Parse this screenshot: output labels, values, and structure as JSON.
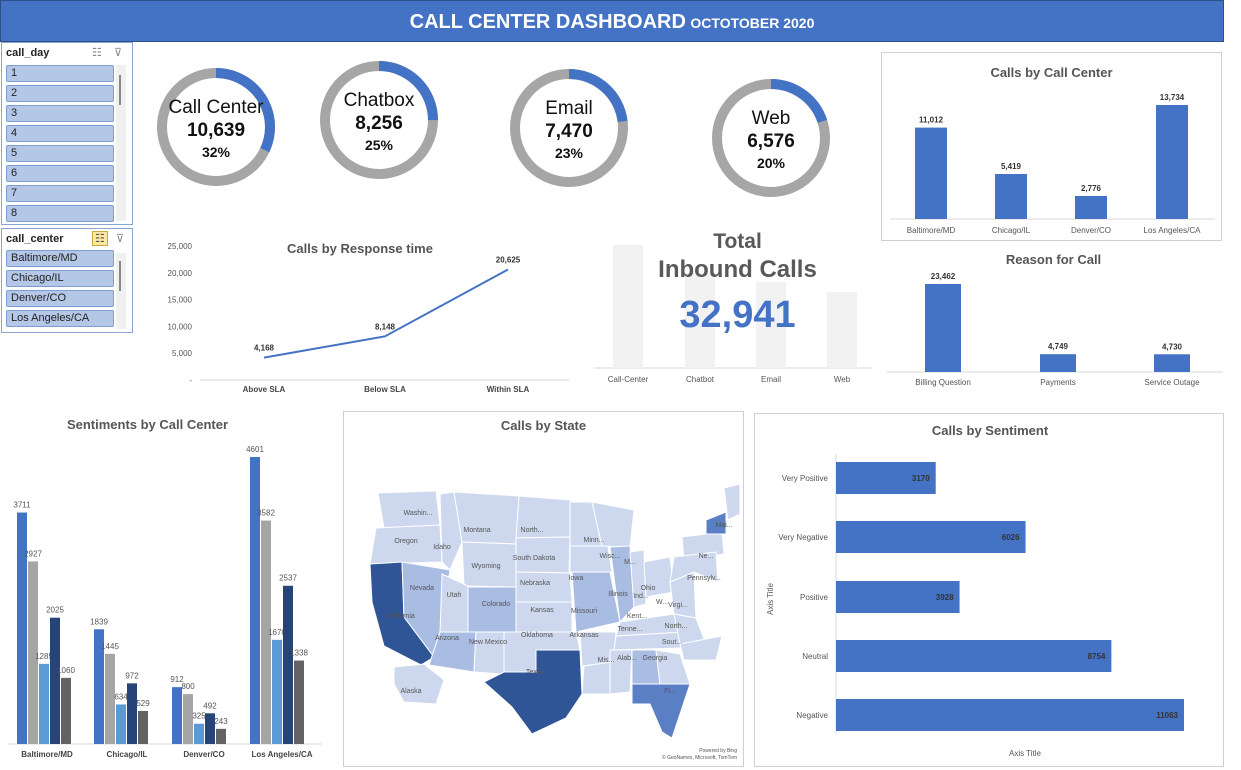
{
  "header": {
    "title": "CALL CENTER DASHBOARD",
    "subtitle": "OCTOTOBER 2020"
  },
  "slicer_day": {
    "title": "call_day",
    "items": [
      "1",
      "2",
      "3",
      "4",
      "5",
      "6",
      "7",
      "8"
    ]
  },
  "slicer_center": {
    "title": "call_center",
    "items": [
      "Baltimore/MD",
      "Chicago/IL",
      "Denver/CO",
      "Los Angeles/CA"
    ]
  },
  "kpis": [
    {
      "label": "Call Center",
      "value": "10,639",
      "pct": "32%",
      "fraction": 0.32
    },
    {
      "label": "Chatbox",
      "value": "8,256",
      "pct": "25%",
      "fraction": 0.25
    },
    {
      "label": "Email",
      "value": "7,470",
      "pct": "23%",
      "fraction": 0.23
    },
    {
      "label": "Web",
      "value": "6,576",
      "pct": "20%",
      "fraction": 0.2
    }
  ],
  "total": {
    "title_line1": "Total",
    "title_line2": "Inbound Calls",
    "value": "32,941"
  },
  "colors": {
    "accent": "#4472c4",
    "ring_gray": "#a6a6a6",
    "dark_blue": "#264478",
    "light_blue": "#5b9bd5",
    "dark_gray": "#636363"
  },
  "chart_data": [
    {
      "id": "calls_by_call_center",
      "type": "bar",
      "title": "Calls by Call Center",
      "categories": [
        "Baltimore/MD",
        "Chicago/IL",
        "Denver/CO",
        "Los Angeles/CA"
      ],
      "values": [
        11012,
        5419,
        2776,
        13734
      ],
      "labels": [
        "11,012",
        "5,419",
        "2,776",
        "13,734"
      ]
    },
    {
      "id": "calls_by_response_time",
      "type": "line",
      "title": "Calls by Response time",
      "categories": [
        "Above SLA",
        "Below SLA",
        "Within SLA"
      ],
      "values": [
        4168,
        8148,
        20625
      ],
      "labels": [
        "4,168",
        "8,148",
        "20,625"
      ],
      "yticks": [
        "25,000",
        "20,000",
        "15,000",
        "10,000",
        "5,000",
        "-"
      ],
      "ylim": [
        0,
        25000
      ]
    },
    {
      "id": "total_inbound_background",
      "type": "bar",
      "categories": [
        "Call-Center",
        "Chatbot",
        "Email",
        "Web"
      ],
      "values": [
        10639,
        8256,
        7470,
        6576
      ]
    },
    {
      "id": "reason_for_call",
      "type": "bar",
      "title": "Reason for Call",
      "categories": [
        "Billing Question",
        "Payments",
        "Service Outage"
      ],
      "values": [
        23462,
        4749,
        4730
      ],
      "labels": [
        "23,462",
        "4,749",
        "4,730"
      ]
    },
    {
      "id": "sentiments_by_call_center",
      "type": "bar",
      "title": "Sentiments by Call Center",
      "categories": [
        "Baltimore/MD",
        "Chicago/IL",
        "Denver/CO",
        "Los Angeles/CA"
      ],
      "series": [
        {
          "values": [
            3711,
            1839,
            912,
            4601
          ],
          "color": "#4472c4"
        },
        {
          "values": [
            2927,
            1445,
            800,
            3582
          ],
          "color": "#a5a5a5"
        },
        {
          "values": [
            1285,
            634,
            325,
            1670
          ],
          "color": "#5b9bd5"
        },
        {
          "values": [
            2025,
            972,
            492,
            2537
          ],
          "color": "#264478"
        },
        {
          "values": [
            1060,
            529,
            243,
            1338
          ],
          "color": "#636363"
        }
      ]
    },
    {
      "id": "calls_by_sentiment",
      "type": "bar",
      "orientation": "horizontal",
      "title": "Calls by Sentiment",
      "categories": [
        "Very Positive",
        "Very Negative",
        "Positive",
        "Neutral",
        "Negative"
      ],
      "values": [
        3170,
        6026,
        3928,
        8754,
        11063
      ],
      "xlabel": "Axis Title",
      "ylabel": "Axis Title"
    }
  ],
  "map": {
    "title": "Calls by State",
    "state_labels": [
      "Washin...",
      "Oregon",
      "Idaho",
      "Montana",
      "North...",
      "Minn...",
      "Wisc...",
      "Mai...",
      "South Dakota",
      "Wyoming",
      "Ne...",
      "M...",
      "Nevada",
      "Utah",
      "Nebraska",
      "Iowa",
      "Pennsylv...",
      "California",
      "Colorado",
      "Kansas",
      "Missouri",
      "Illinois",
      "Ind...",
      "Ohio",
      "W...",
      "Virgi...",
      "Kent...",
      "North...",
      "Arizona",
      "New Mexico",
      "Oklahoma",
      "Arkansas",
      "Tenne...",
      "Sout...",
      "Texas",
      "Mis...",
      "Alab...",
      "Georgia",
      "Fl...",
      "Alaska"
    ],
    "credit_line1": "Powered by Bing",
    "credit_line2": "© GeoNames, Microsoft, TomTom"
  }
}
